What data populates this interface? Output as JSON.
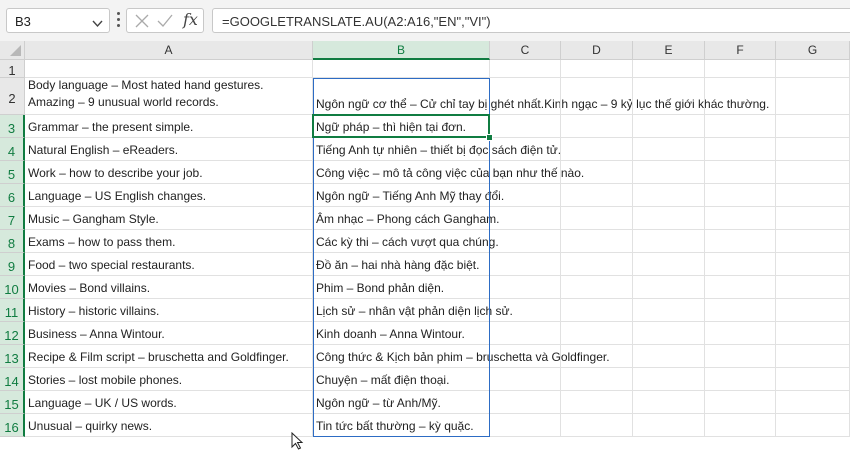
{
  "formula_bar": {
    "name_box": "B3",
    "formula": "=GOOGLETRANSLATE.AU(A2:A16,\"EN\",\"VI\")",
    "icons": [
      "chevron-down-icon",
      "more-icon",
      "cancel-icon",
      "enter-icon",
      "fx-icon"
    ]
  },
  "columns": [
    "A",
    "B",
    "C",
    "D",
    "E",
    "F",
    "G"
  ],
  "selected_column": "B",
  "rows": [
    {
      "num": "1",
      "a": "",
      "b": ""
    },
    {
      "num": "2",
      "a": "Body language – Most hated hand gestures. Amazing – 9 unusual world records.",
      "b": "Ngôn ngữ cơ thể – Cử chỉ tay bị ghét nhất.Kinh ngạc – 9 kỷ lục thế giới khác thường."
    },
    {
      "num": "3",
      "a": "Grammar – the present simple.",
      "b": "Ngữ pháp – thì hiện tại đơn."
    },
    {
      "num": "4",
      "a": "Natural English – eReaders.",
      "b": "Tiếng Anh tự nhiên – thiết bị đọc sách điện tử."
    },
    {
      "num": "5",
      "a": "Work – how to describe your job.",
      "b": "Công việc – mô tả công việc của bạn như thế nào."
    },
    {
      "num": "6",
      "a": "Language – US English changes.",
      "b": "Ngôn ngữ – Tiếng Anh Mỹ thay đổi."
    },
    {
      "num": "7",
      "a": "Music – Gangham Style.",
      "b": "Âm nhạc – Phong cách Gangham."
    },
    {
      "num": "8",
      "a": "Exams – how to pass them.",
      "b": "Các kỳ thi – cách vượt qua chúng."
    },
    {
      "num": "9",
      "a": "Food – two special restaurants.",
      "b": "Đồ ăn – hai nhà hàng đặc biệt."
    },
    {
      "num": "10",
      "a": "Movies – Bond villains.",
      "b": "Phim – Bond phản diện."
    },
    {
      "num": "11",
      "a": "History – historic villains.",
      "b": "Lịch sử – nhân vật phản diện lịch sử."
    },
    {
      "num": "12",
      "a": "Business – Anna Wintour.",
      "b": "Kinh doanh – Anna Wintour."
    },
    {
      "num": "13",
      "a": "Recipe & Film script – bruschetta and Goldfinger.",
      "b": "Công thức & Kịch bản phim – bruschetta và Goldfinger."
    },
    {
      "num": "14",
      "a": "Stories – lost mobile phones.",
      "b": "Chuyện – mất điện thoại."
    },
    {
      "num": "15",
      "a": "Language – UK / US words.",
      "b": "Ngôn ngữ – từ Anh/Mỹ."
    },
    {
      "num": "16",
      "a": "Unusual – quirky news.",
      "b": "Tin tức bất thường – kỳ quặc."
    }
  ],
  "colors": {
    "accent": "#107c41",
    "selection": "#2d6cc4",
    "header_bg": "#e8e8e8"
  }
}
